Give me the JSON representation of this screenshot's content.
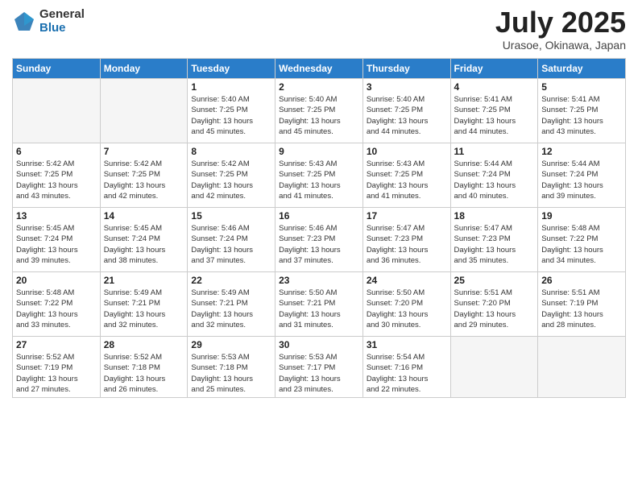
{
  "logo": {
    "general": "General",
    "blue": "Blue"
  },
  "header": {
    "month_year": "July 2025",
    "location": "Urasoe, Okinawa, Japan"
  },
  "weekdays": [
    "Sunday",
    "Monday",
    "Tuesday",
    "Wednesday",
    "Thursday",
    "Friday",
    "Saturday"
  ],
  "weeks": [
    [
      {
        "day": "",
        "info": ""
      },
      {
        "day": "",
        "info": ""
      },
      {
        "day": "1",
        "info": "Sunrise: 5:40 AM\nSunset: 7:25 PM\nDaylight: 13 hours\nand 45 minutes."
      },
      {
        "day": "2",
        "info": "Sunrise: 5:40 AM\nSunset: 7:25 PM\nDaylight: 13 hours\nand 45 minutes."
      },
      {
        "day": "3",
        "info": "Sunrise: 5:40 AM\nSunset: 7:25 PM\nDaylight: 13 hours\nand 44 minutes."
      },
      {
        "day": "4",
        "info": "Sunrise: 5:41 AM\nSunset: 7:25 PM\nDaylight: 13 hours\nand 44 minutes."
      },
      {
        "day": "5",
        "info": "Sunrise: 5:41 AM\nSunset: 7:25 PM\nDaylight: 13 hours\nand 43 minutes."
      }
    ],
    [
      {
        "day": "6",
        "info": "Sunrise: 5:42 AM\nSunset: 7:25 PM\nDaylight: 13 hours\nand 43 minutes."
      },
      {
        "day": "7",
        "info": "Sunrise: 5:42 AM\nSunset: 7:25 PM\nDaylight: 13 hours\nand 42 minutes."
      },
      {
        "day": "8",
        "info": "Sunrise: 5:42 AM\nSunset: 7:25 PM\nDaylight: 13 hours\nand 42 minutes."
      },
      {
        "day": "9",
        "info": "Sunrise: 5:43 AM\nSunset: 7:25 PM\nDaylight: 13 hours\nand 41 minutes."
      },
      {
        "day": "10",
        "info": "Sunrise: 5:43 AM\nSunset: 7:25 PM\nDaylight: 13 hours\nand 41 minutes."
      },
      {
        "day": "11",
        "info": "Sunrise: 5:44 AM\nSunset: 7:24 PM\nDaylight: 13 hours\nand 40 minutes."
      },
      {
        "day": "12",
        "info": "Sunrise: 5:44 AM\nSunset: 7:24 PM\nDaylight: 13 hours\nand 39 minutes."
      }
    ],
    [
      {
        "day": "13",
        "info": "Sunrise: 5:45 AM\nSunset: 7:24 PM\nDaylight: 13 hours\nand 39 minutes."
      },
      {
        "day": "14",
        "info": "Sunrise: 5:45 AM\nSunset: 7:24 PM\nDaylight: 13 hours\nand 38 minutes."
      },
      {
        "day": "15",
        "info": "Sunrise: 5:46 AM\nSunset: 7:24 PM\nDaylight: 13 hours\nand 37 minutes."
      },
      {
        "day": "16",
        "info": "Sunrise: 5:46 AM\nSunset: 7:23 PM\nDaylight: 13 hours\nand 37 minutes."
      },
      {
        "day": "17",
        "info": "Sunrise: 5:47 AM\nSunset: 7:23 PM\nDaylight: 13 hours\nand 36 minutes."
      },
      {
        "day": "18",
        "info": "Sunrise: 5:47 AM\nSunset: 7:23 PM\nDaylight: 13 hours\nand 35 minutes."
      },
      {
        "day": "19",
        "info": "Sunrise: 5:48 AM\nSunset: 7:22 PM\nDaylight: 13 hours\nand 34 minutes."
      }
    ],
    [
      {
        "day": "20",
        "info": "Sunrise: 5:48 AM\nSunset: 7:22 PM\nDaylight: 13 hours\nand 33 minutes."
      },
      {
        "day": "21",
        "info": "Sunrise: 5:49 AM\nSunset: 7:21 PM\nDaylight: 13 hours\nand 32 minutes."
      },
      {
        "day": "22",
        "info": "Sunrise: 5:49 AM\nSunset: 7:21 PM\nDaylight: 13 hours\nand 32 minutes."
      },
      {
        "day": "23",
        "info": "Sunrise: 5:50 AM\nSunset: 7:21 PM\nDaylight: 13 hours\nand 31 minutes."
      },
      {
        "day": "24",
        "info": "Sunrise: 5:50 AM\nSunset: 7:20 PM\nDaylight: 13 hours\nand 30 minutes."
      },
      {
        "day": "25",
        "info": "Sunrise: 5:51 AM\nSunset: 7:20 PM\nDaylight: 13 hours\nand 29 minutes."
      },
      {
        "day": "26",
        "info": "Sunrise: 5:51 AM\nSunset: 7:19 PM\nDaylight: 13 hours\nand 28 minutes."
      }
    ],
    [
      {
        "day": "27",
        "info": "Sunrise: 5:52 AM\nSunset: 7:19 PM\nDaylight: 13 hours\nand 27 minutes."
      },
      {
        "day": "28",
        "info": "Sunrise: 5:52 AM\nSunset: 7:18 PM\nDaylight: 13 hours\nand 26 minutes."
      },
      {
        "day": "29",
        "info": "Sunrise: 5:53 AM\nSunset: 7:18 PM\nDaylight: 13 hours\nand 25 minutes."
      },
      {
        "day": "30",
        "info": "Sunrise: 5:53 AM\nSunset: 7:17 PM\nDaylight: 13 hours\nand 23 minutes."
      },
      {
        "day": "31",
        "info": "Sunrise: 5:54 AM\nSunset: 7:16 PM\nDaylight: 13 hours\nand 22 minutes."
      },
      {
        "day": "",
        "info": ""
      },
      {
        "day": "",
        "info": ""
      }
    ]
  ]
}
